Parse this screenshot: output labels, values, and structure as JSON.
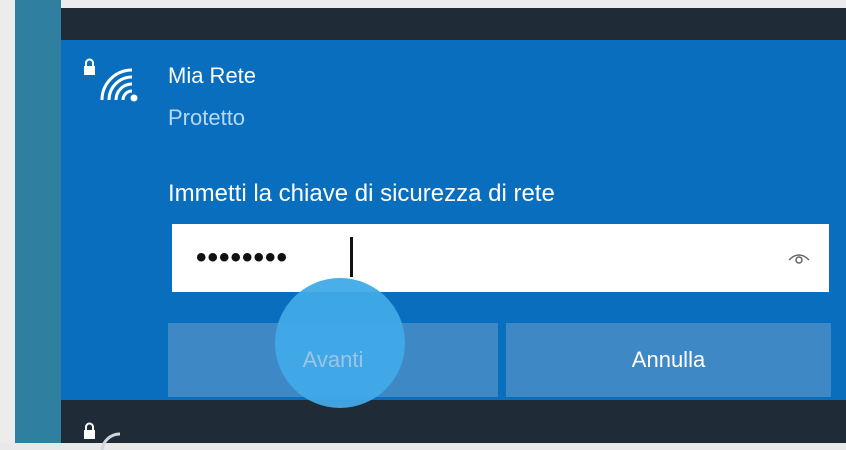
{
  "network": {
    "name": "Mia Rete",
    "status": "Protetto",
    "icon": "wifi-secured-icon"
  },
  "password": {
    "prompt": "Immetti la chiave di sicurezza di rete",
    "masked_value": "••••••••",
    "reveal_icon": "eye-icon"
  },
  "buttons": {
    "next_label": "Avanti",
    "cancel_label": "Annulla"
  },
  "colors": {
    "panel": "#0a6ebf",
    "button": "#3f88c6",
    "touch_indicator": "#40aae8",
    "dark_bar": "#1f2b36"
  }
}
